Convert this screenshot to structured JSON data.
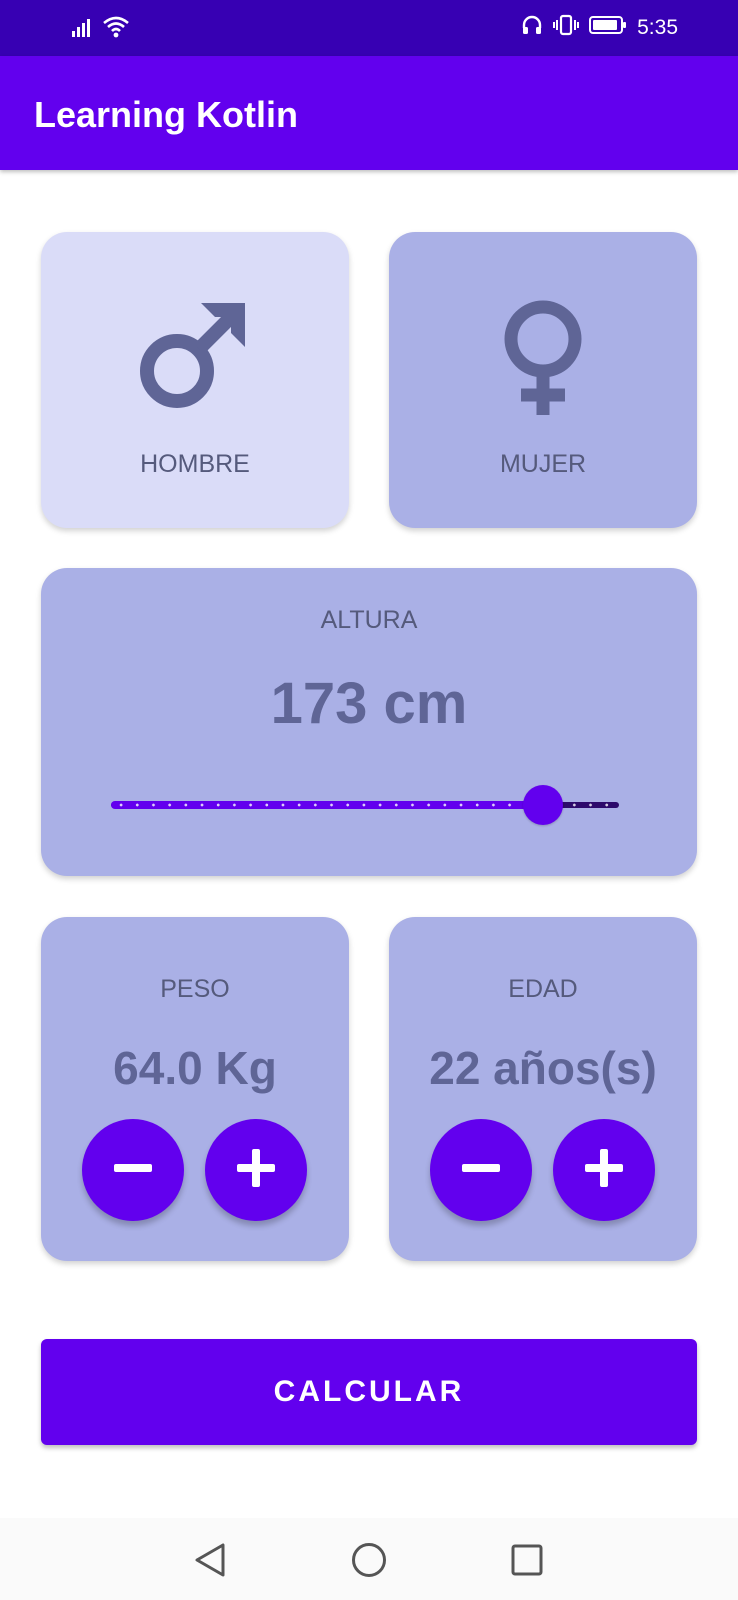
{
  "status_bar": {
    "time": "5:35",
    "icons": [
      "signal-icon",
      "wifi-icon",
      "headphones-icon",
      "vibrate-icon",
      "battery-icon"
    ]
  },
  "app_bar": {
    "title": "Learning Kotlin"
  },
  "gender": {
    "male": {
      "label": "HOMBRE",
      "icon": "male-symbol-icon",
      "selected": true
    },
    "female": {
      "label": "MUJER",
      "icon": "female-symbol-icon",
      "selected": false
    }
  },
  "height": {
    "label": "ALTURA",
    "value_text": "173 cm",
    "slider_fraction": 0.85
  },
  "weight": {
    "label": "PESO",
    "value_text": "64.0 Kg",
    "decrement_icon": "minus-icon",
    "increment_icon": "plus-icon"
  },
  "age": {
    "label": "EDAD",
    "value_text": "22 años(s)",
    "decrement_icon": "minus-icon",
    "increment_icon": "plus-icon"
  },
  "calculate_button": {
    "label": "CALCULAR"
  },
  "nav_bar": {
    "icons": [
      "back-icon",
      "home-icon",
      "recents-icon"
    ]
  },
  "colors": {
    "primary": "#6200ee",
    "primary_dark": "#3700b3",
    "card": "#aab0e6",
    "card_selected": "#dadcf8",
    "text_muted": "#555a7c",
    "value_text": "#5f6596"
  }
}
